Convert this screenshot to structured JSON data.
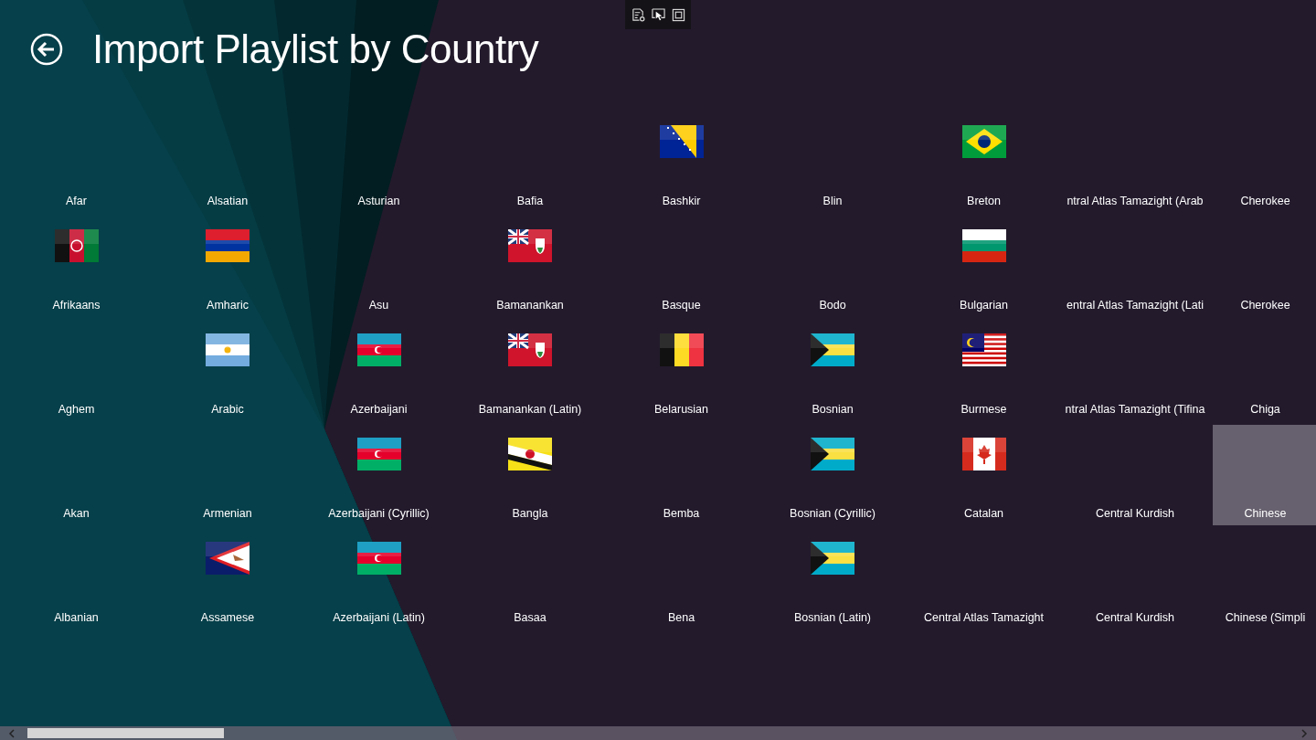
{
  "title": "Import Playlist by Country",
  "columns": [
    [
      {
        "label": "Afar",
        "kind": "text",
        "selected": false
      },
      {
        "label": "Afrikaans",
        "kind": "af",
        "selected": false
      },
      {
        "label": "Aghem",
        "kind": "text",
        "selected": false
      },
      {
        "label": "Akan",
        "kind": "text",
        "selected": false
      },
      {
        "label": "Albanian",
        "kind": "text",
        "selected": false
      }
    ],
    [
      {
        "label": "Alsatian",
        "kind": "text",
        "selected": false
      },
      {
        "label": "Amharic",
        "kind": "am",
        "selected": false
      },
      {
        "label": "Arabic",
        "kind": "ar",
        "selected": false
      },
      {
        "label": "Armenian",
        "kind": "text",
        "selected": false
      },
      {
        "label": "Assamese",
        "kind": "as",
        "selected": false
      }
    ],
    [
      {
        "label": "Asturian",
        "kind": "text",
        "selected": false
      },
      {
        "label": "Asu",
        "kind": "text",
        "selected": false
      },
      {
        "label": "Azerbaijani",
        "kind": "az",
        "selected": false
      },
      {
        "label": "Azerbaijani (Cyrillic)",
        "kind": "az",
        "selected": false
      },
      {
        "label": "Azerbaijani (Latin)",
        "kind": "az",
        "selected": false
      }
    ],
    [
      {
        "label": "Bafia",
        "kind": "text",
        "selected": false
      },
      {
        "label": "Bamanankan",
        "kind": "bm",
        "selected": false
      },
      {
        "label": "Bamanankan (Latin)",
        "kind": "bm",
        "selected": false
      },
      {
        "label": "Bangla",
        "kind": "bn",
        "selected": false
      },
      {
        "label": "Basaa",
        "kind": "text",
        "selected": false
      }
    ],
    [
      {
        "label": "Bashkir",
        "kind": "ba",
        "selected": false
      },
      {
        "label": "Basque",
        "kind": "text",
        "selected": false
      },
      {
        "label": "Belarusian",
        "kind": "be",
        "selected": false
      },
      {
        "label": "Bemba",
        "kind": "text",
        "selected": false
      },
      {
        "label": "Bena",
        "kind": "text",
        "selected": false
      }
    ],
    [
      {
        "label": "Blin",
        "kind": "text",
        "selected": false
      },
      {
        "label": "Bodo",
        "kind": "text",
        "selected": false
      },
      {
        "label": "Bosnian",
        "kind": "bs",
        "selected": false
      },
      {
        "label": "Bosnian (Cyrillic)",
        "kind": "bs",
        "selected": false
      },
      {
        "label": "Bosnian (Latin)",
        "kind": "bs",
        "selected": false
      }
    ],
    [
      {
        "label": "Breton",
        "kind": "br",
        "selected": false
      },
      {
        "label": "Bulgarian",
        "kind": "bg",
        "selected": false
      },
      {
        "label": "Burmese",
        "kind": "my",
        "selected": false
      },
      {
        "label": "Catalan",
        "kind": "ca",
        "selected": false
      },
      {
        "label": "Central Atlas Tamazight",
        "kind": "text",
        "selected": false
      }
    ],
    [
      {
        "label": "ntral Atlas Tamazight (Arab",
        "kind": "text",
        "selected": false
      },
      {
        "label": "entral Atlas Tamazight (Lati",
        "kind": "text",
        "selected": false
      },
      {
        "label": "ntral Atlas Tamazight (Tifina",
        "kind": "text",
        "selected": false
      },
      {
        "label": "Central Kurdish",
        "kind": "text",
        "selected": false
      },
      {
        "label": "Central Kurdish",
        "kind": "text",
        "selected": false
      }
    ],
    [
      {
        "label": "Cherokee",
        "kind": "text",
        "selected": false
      },
      {
        "label": "Cherokee",
        "kind": "text",
        "selected": false
      },
      {
        "label": "Chiga",
        "kind": "text",
        "selected": false
      },
      {
        "label": "Chinese",
        "kind": "text",
        "selected": true
      },
      {
        "label": "Chinese (Simpli",
        "kind": "text",
        "selected": false
      }
    ]
  ]
}
